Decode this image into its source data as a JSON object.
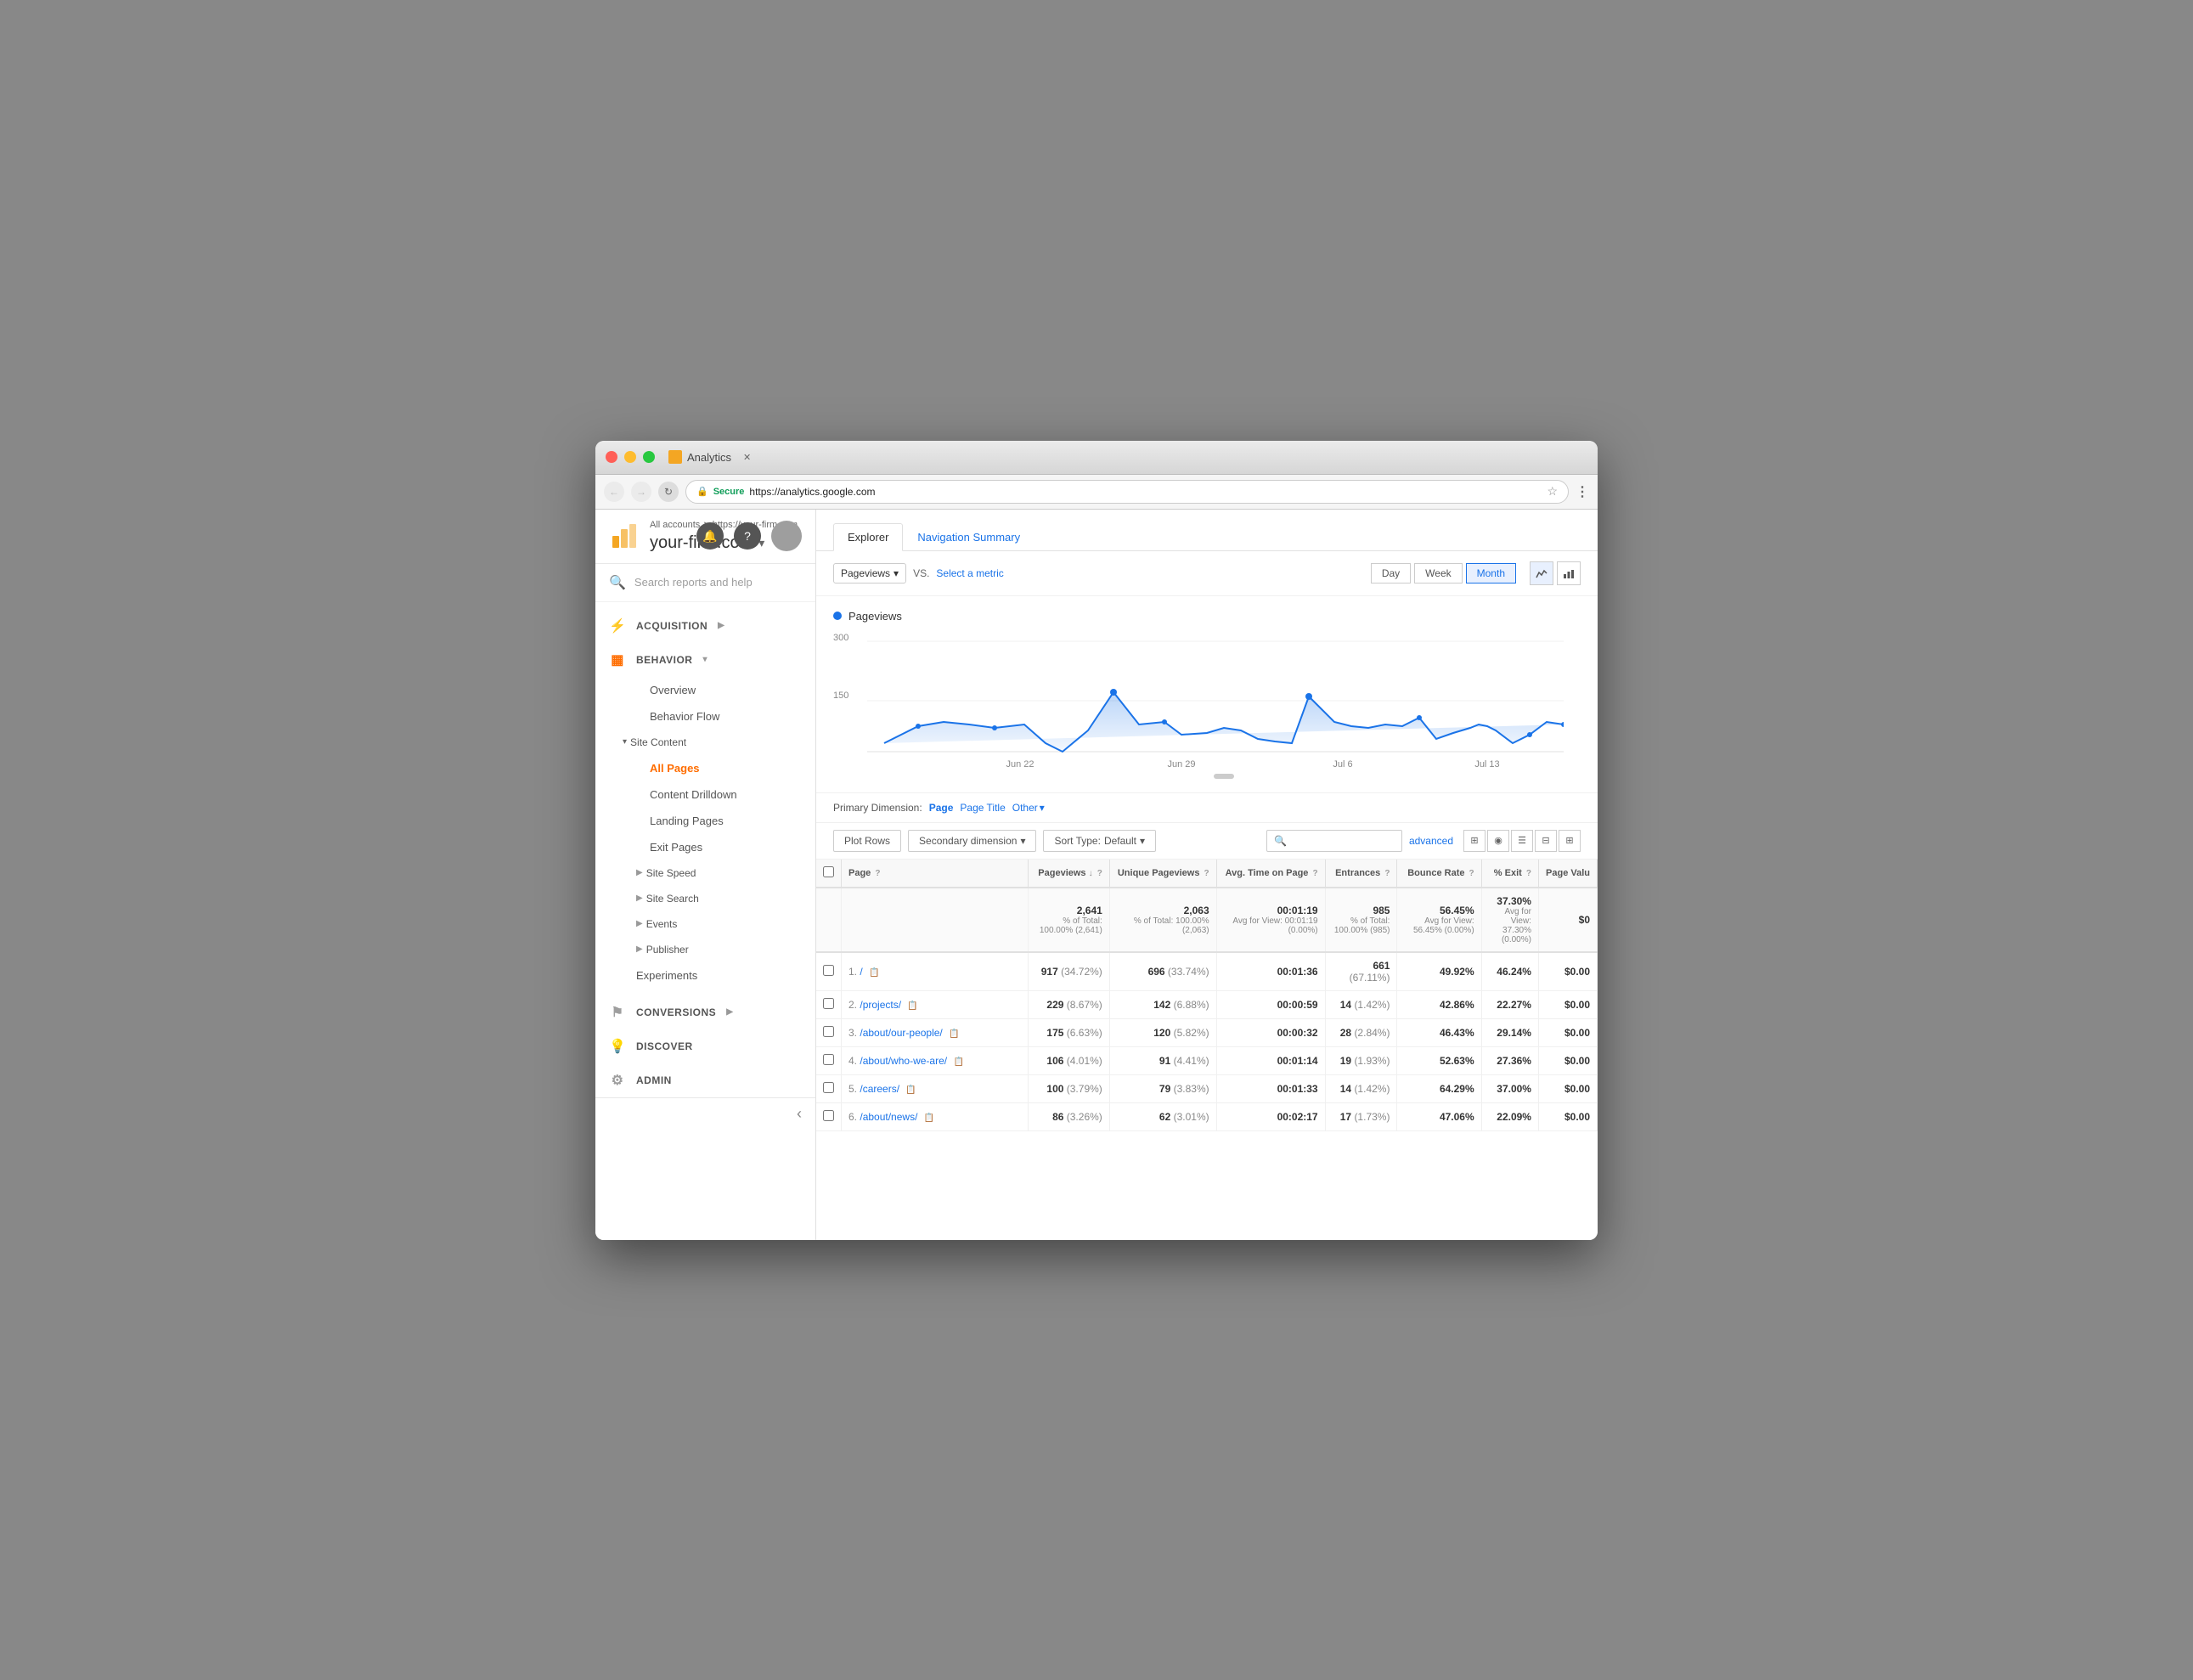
{
  "window": {
    "title": "Analytics",
    "url": "https://analytics.google.com",
    "secure_label": "Secure"
  },
  "account": {
    "breadcrumb": "All accounts > https://your-firm.com",
    "name": "your-firm.com",
    "breadcrumb_part1": "All accounts",
    "breadcrumb_sep": ">",
    "breadcrumb_part2": "https://your-firm.com"
  },
  "sidebar": {
    "search_placeholder": "Search reports and help",
    "nav_items": [
      {
        "id": "acquisition",
        "label": "ACQUISITION",
        "icon": "⚡"
      },
      {
        "id": "behavior",
        "label": "BEHAVIOR",
        "icon": "▦"
      }
    ],
    "behavior_sub": [
      {
        "label": "Overview",
        "active": false
      },
      {
        "label": "Behavior Flow",
        "active": false
      }
    ],
    "site_content_label": "Site Content",
    "site_content_items": [
      {
        "label": "All Pages",
        "active": true
      },
      {
        "label": "Content Drilldown",
        "active": false
      },
      {
        "label": "Landing Pages",
        "active": false
      },
      {
        "label": "Exit Pages",
        "active": false
      }
    ],
    "collapsible_items": [
      {
        "label": "Site Speed"
      },
      {
        "label": "Site Search"
      },
      {
        "label": "Events"
      },
      {
        "label": "Publisher"
      }
    ],
    "experiments_label": "Experiments",
    "conversions_label": "CONVERSIONS",
    "discover_label": "DISCOVER",
    "admin_label": "ADMIN",
    "collapse_icon": "‹"
  },
  "explorer_tab": "Explorer",
  "nav_summary_tab": "Navigation Summary",
  "chart": {
    "metric_label": "Pageviews",
    "vs_label": "VS.",
    "select_metric": "Select a metric",
    "time_buttons": [
      "Day",
      "Week",
      "Month"
    ],
    "active_time": "Month",
    "legend_label": "Pageviews",
    "y_labels": [
      "300",
      "150"
    ],
    "x_labels": [
      "Jun 22",
      "Jun 29",
      "Jul 6",
      "Jul 13"
    ]
  },
  "primary_dimension": {
    "label": "Primary Dimension:",
    "options": [
      "Page",
      "Page Title",
      "Other"
    ]
  },
  "table_controls": {
    "plot_rows": "Plot Rows",
    "secondary_dimension": "Secondary dimension",
    "sort_type": "Default",
    "advanced": "advanced"
  },
  "table": {
    "headers": [
      {
        "label": "Page",
        "has_help": true
      },
      {
        "label": "Pageviews",
        "has_sort": true,
        "has_help": true
      },
      {
        "label": "Unique Pageviews",
        "has_help": true
      },
      {
        "label": "Avg. Time on Page",
        "has_help": true
      },
      {
        "label": "Entrances",
        "has_help": true
      },
      {
        "label": "Bounce Rate",
        "has_help": true
      },
      {
        "label": "% Exit",
        "has_help": true
      },
      {
        "label": "Page Valu",
        "has_help": false
      }
    ],
    "summary": {
      "pageviews": "2,641",
      "pageviews_sub": "% of Total: 100.00% (2,641)",
      "unique": "2,063",
      "unique_sub": "% of Total: 100.00% (2,063)",
      "avg_time": "00:01:19",
      "avg_time_sub": "Avg for View: 00:01:19 (0.00%)",
      "entrances": "985",
      "entrances_sub": "% of Total: 100.00% (985)",
      "bounce": "56.45%",
      "bounce_sub": "Avg for View: 56.45% (0.00%)",
      "exit": "37.30%",
      "exit_sub": "Avg for View: 37.30% (0.00%)",
      "page_value": "$0"
    },
    "rows": [
      {
        "num": "1.",
        "page": "/",
        "pageviews": "917",
        "pv_pct": "(34.72%)",
        "unique": "696",
        "uniq_pct": "(33.74%)",
        "avg_time": "00:01:36",
        "entrances": "661",
        "entr_pct": "(67.11%)",
        "bounce": "49.92%",
        "exit": "46.24%",
        "page_value": "$0.00"
      },
      {
        "num": "2.",
        "page": "/projects/",
        "pageviews": "229",
        "pv_pct": "(8.67%)",
        "unique": "142",
        "uniq_pct": "(6.88%)",
        "avg_time": "00:00:59",
        "entrances": "14",
        "entr_pct": "(1.42%)",
        "bounce": "42.86%",
        "exit": "22.27%",
        "page_value": "$0.00"
      },
      {
        "num": "3.",
        "page": "/about/our-people/",
        "pageviews": "175",
        "pv_pct": "(6.63%)",
        "unique": "120",
        "uniq_pct": "(5.82%)",
        "avg_time": "00:00:32",
        "entrances": "28",
        "entr_pct": "(2.84%)",
        "bounce": "46.43%",
        "exit": "29.14%",
        "page_value": "$0.00"
      },
      {
        "num": "4.",
        "page": "/about/who-we-are/",
        "pageviews": "106",
        "pv_pct": "(4.01%)",
        "unique": "91",
        "uniq_pct": "(4.41%)",
        "avg_time": "00:01:14",
        "entrances": "19",
        "entr_pct": "(1.93%)",
        "bounce": "52.63%",
        "exit": "27.36%",
        "page_value": "$0.00"
      },
      {
        "num": "5.",
        "page": "/careers/",
        "pageviews": "100",
        "pv_pct": "(3.79%)",
        "unique": "79",
        "uniq_pct": "(3.83%)",
        "avg_time": "00:01:33",
        "entrances": "14",
        "entr_pct": "(1.42%)",
        "bounce": "64.29%",
        "exit": "37.00%",
        "page_value": "$0.00"
      },
      {
        "num": "6.",
        "page": "/about/news/",
        "pageviews": "86",
        "pv_pct": "(3.26%)",
        "unique": "62",
        "uniq_pct": "(3.01%)",
        "avg_time": "00:02:17",
        "entrances": "17",
        "entr_pct": "(1.73%)",
        "bounce": "47.06%",
        "exit": "22.09%",
        "page_value": "$0.00"
      }
    ]
  }
}
